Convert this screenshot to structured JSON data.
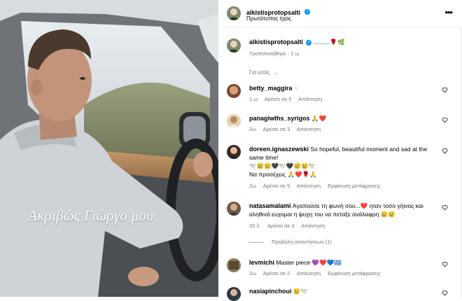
{
  "video": {
    "overlay_caption": "Ακριβώς Γιώργο μου"
  },
  "header": {
    "username": "alkistisprotopsalti",
    "subtitle": "Πρωτότυπος ήχος"
  },
  "caption_post": {
    "username": "alkistisprotopsalti",
    "text": "..........🌹🌿",
    "meta": "Τροποποιήθηκε · 1 ω"
  },
  "filter_label": "Για εσάς",
  "comments": [
    {
      "username": "betty_maggira",
      "text": "♡",
      "time": "1 ω",
      "likes": "Αρέσει σε 5",
      "reply": "Απάντηση",
      "translate": ""
    },
    {
      "username": "panagiwths_syrigos",
      "text": "🙏❤️",
      "time": "2ω",
      "likes": "Αρέσει σε 3",
      "reply": "Απάντηση",
      "translate": ""
    },
    {
      "username": "doreen.ignaszewski",
      "text": "So hopeful, beautiful moment and sad at the same time!",
      "text2": "🕊️😢😢🖤🕊️🖤😢😢🕊️",
      "text3": "Να προσέχεις 🙏❤️🌹🙏",
      "time": "2ω",
      "likes": "Αρέσει σε 5",
      "reply": "Απάντηση",
      "translate": "Εμφάνιση μετάφρασης"
    },
    {
      "username": "natasamalami",
      "text": "Αγαπούσε τη φωνή σου...❤️ ηταν τοσο γήινος και αληθινά ευχομαι η ψυχη του να πεταξε ανάλαφρη 😢😢",
      "time": "33 λ.",
      "likes": "Αρέσει σε 3",
      "reply": "Απάντηση",
      "translate": ""
    },
    {
      "username": "levmichi",
      "text": "Master piece 💜❤️💙🇬🇷",
      "time": "2ω",
      "likes": "Αρέσει σε 2",
      "reply": "Απάντηση",
      "translate": "Εμφάνιση μετάφρασης"
    },
    {
      "username": "nasiapinchoui",
      "text": "😢🕊️",
      "time": "",
      "likes": "",
      "reply": "",
      "translate": ""
    }
  ],
  "view_replies": "Προβολή απαντήσεων (1)",
  "icons": {
    "more": "more-horizontal-icon",
    "heart": "heart-outline-icon",
    "verified": "verified-badge-icon",
    "chevron": "chevron-down-icon"
  },
  "colors": {
    "verified": "#0095f6",
    "secondary_text": "#737373"
  }
}
